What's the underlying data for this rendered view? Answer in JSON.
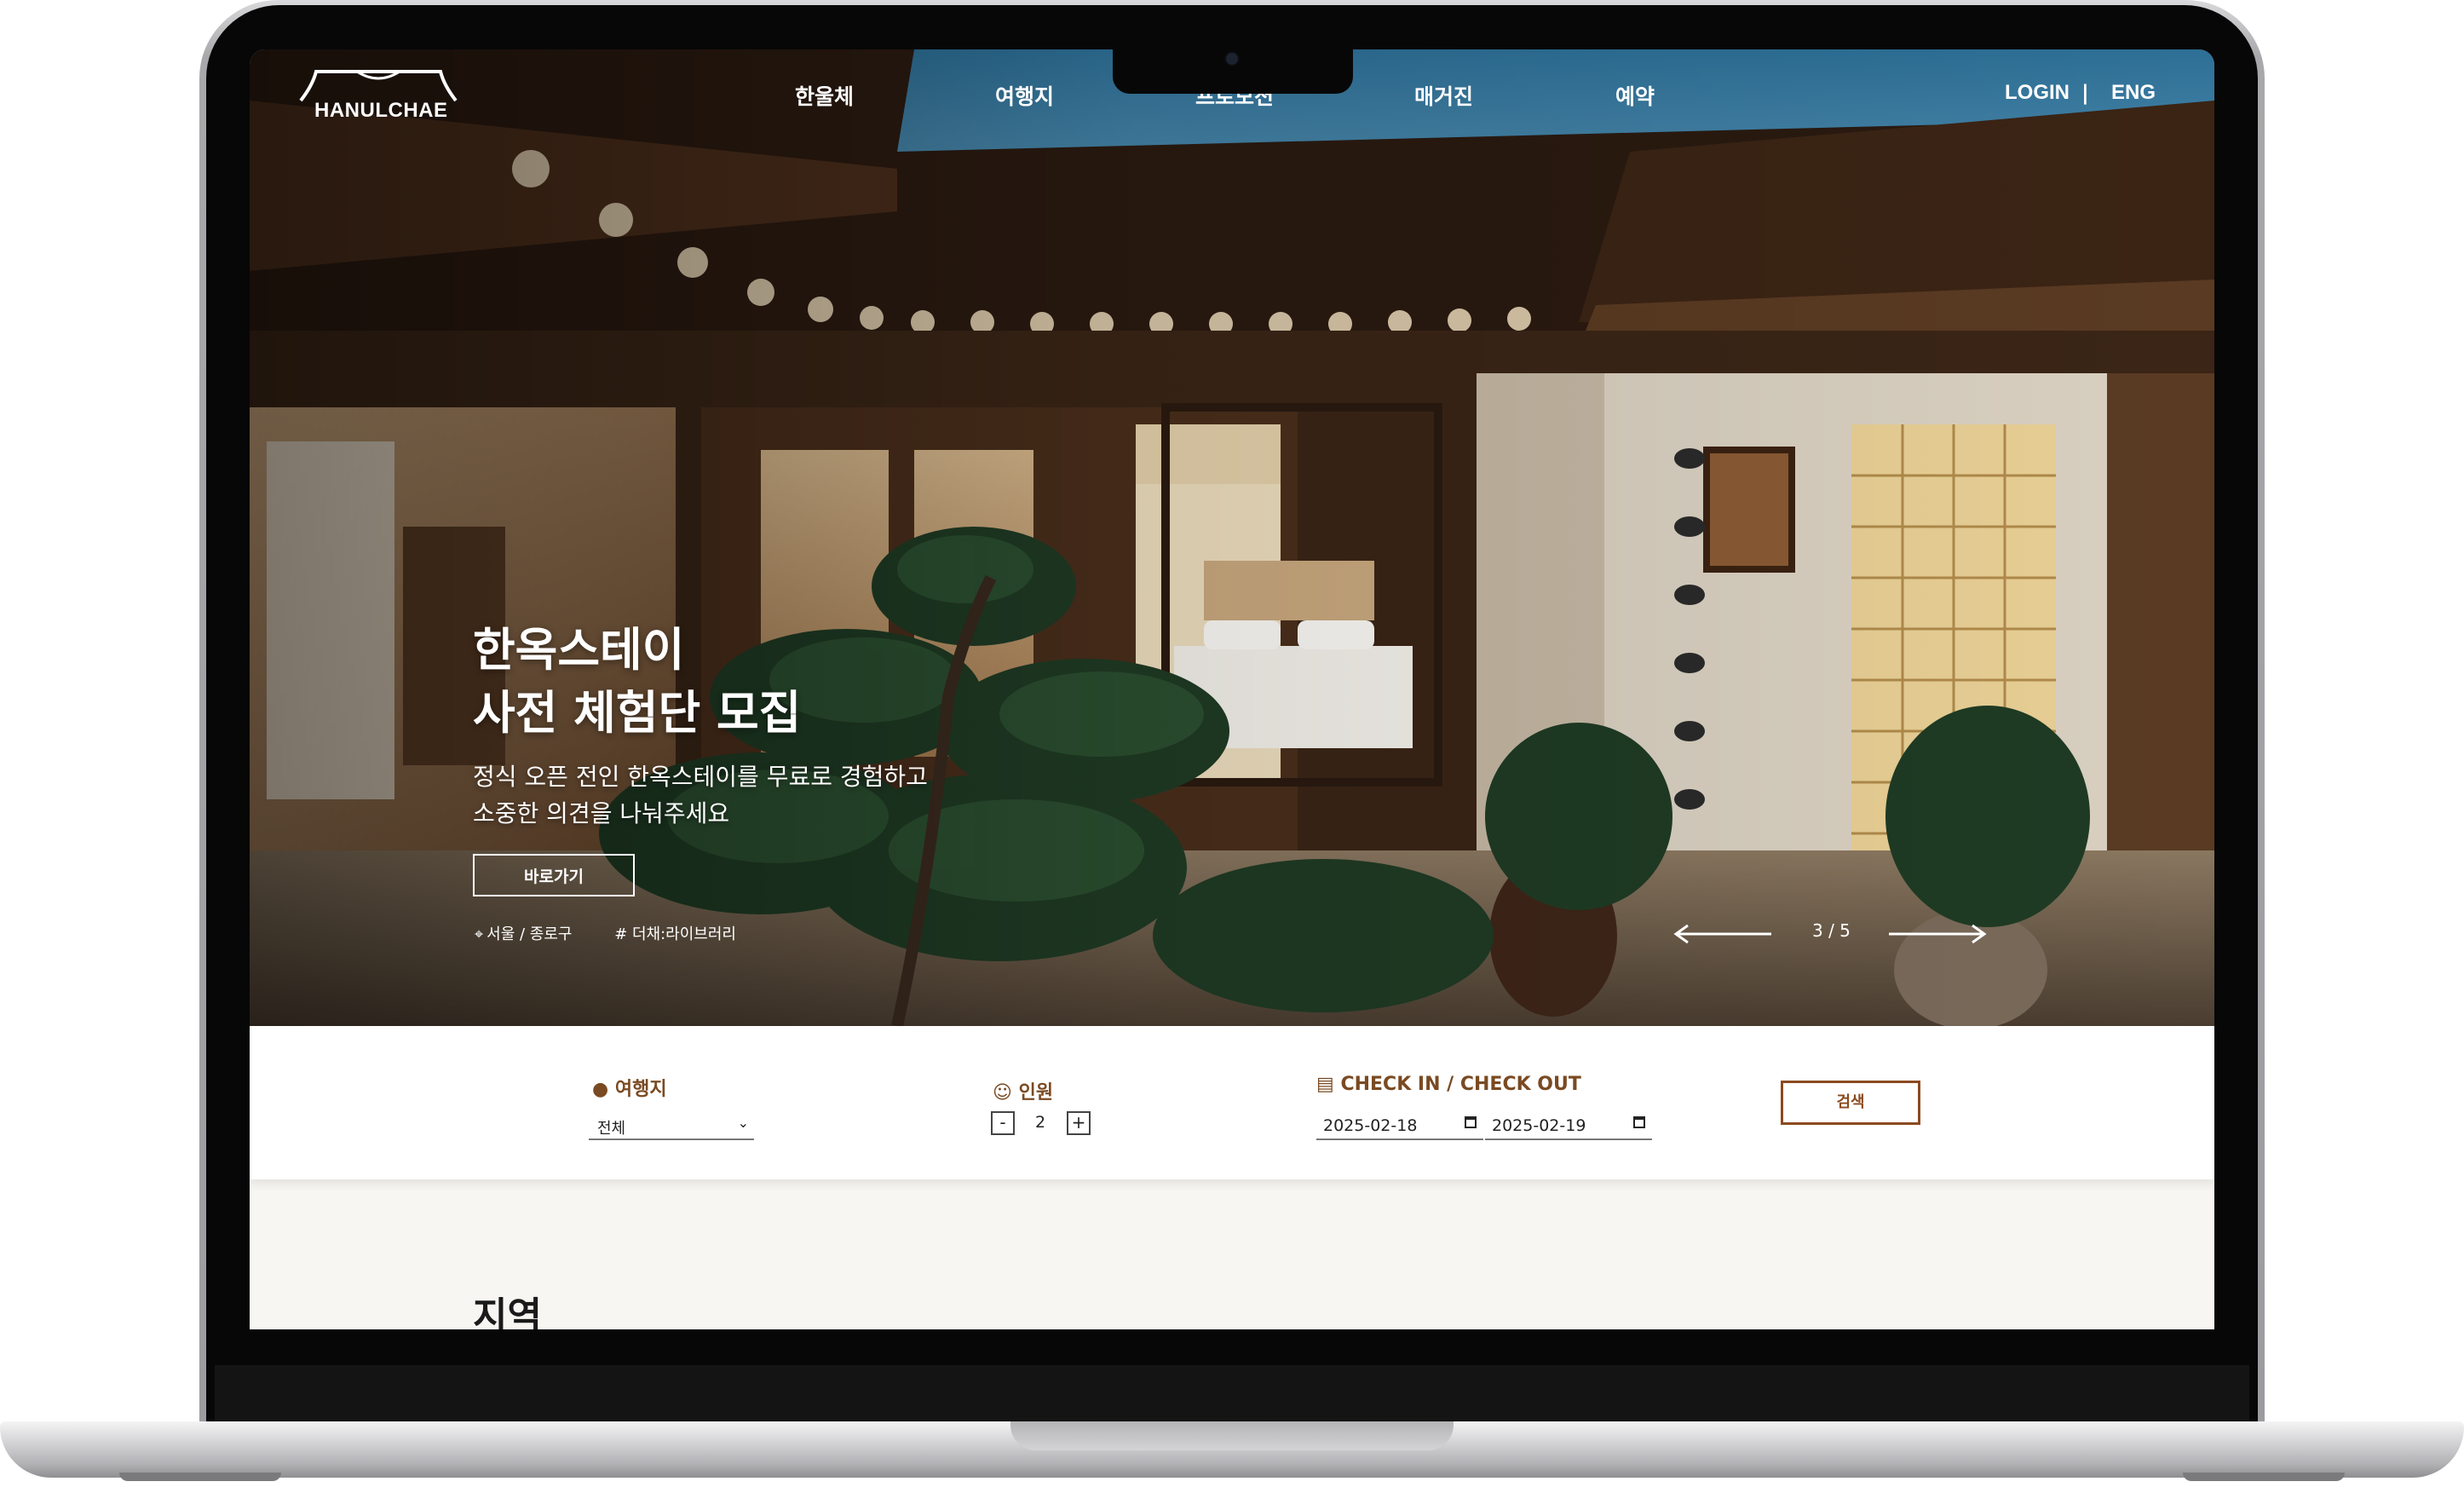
{
  "brand": {
    "logo_text": "HANULCHAE"
  },
  "nav": {
    "items": [
      "한울체",
      "여행지",
      "프로모션",
      "매거진",
      "예약"
    ]
  },
  "utility": {
    "login": "LOGIN",
    "separator": "|",
    "language": "ENG"
  },
  "hero": {
    "title_line1": "한옥스테이",
    "title_line2": "사전 체험단 모집",
    "subtitle_line1": "정식 오픈 전인 한옥스테이를 무료로 경험하고",
    "subtitle_line2": "소중한 의견을 나눠주세요",
    "cta_label": "바로가기",
    "location": "서울 / 종로구",
    "tag": "# 더채:라이브러리",
    "slide_counter": "3 / 5"
  },
  "search": {
    "destination_label": "여행지",
    "destination_value": "전체",
    "guests_label": "인원",
    "guests_minus": "-",
    "guests_value": "2",
    "guests_plus": "+",
    "dates_label": "CHECK IN / CHECK OUT",
    "checkin": "2025-02-18",
    "checkout": "2025-02-19",
    "search_button": "검색"
  },
  "section": {
    "region_title": "지역"
  },
  "icons": [
    "map-pin-icon",
    "person-icon",
    "calendar-icon",
    "chevron-down-icon",
    "arrow-left-icon",
    "arrow-right-icon"
  ],
  "colors": {
    "accent": "#8b4a1f",
    "label": "#7a4a22",
    "section_bg": "#f8f6f2"
  }
}
